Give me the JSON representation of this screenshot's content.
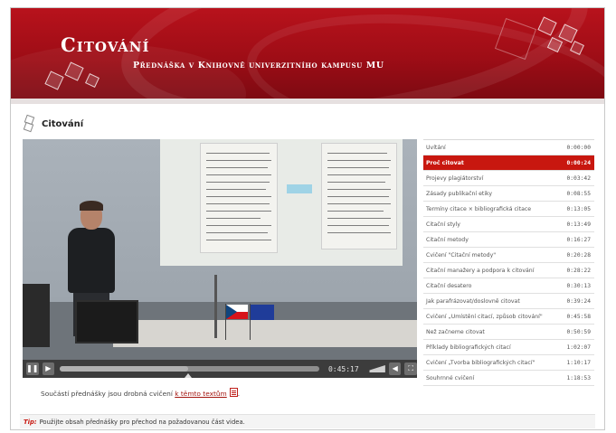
{
  "banner": {
    "title": "Citování",
    "subtitle": "Přednáška v Knihovně univerzitního kampusu MU"
  },
  "page": {
    "heading": "Citování"
  },
  "player": {
    "time": "0:45:17",
    "progress_fraction": 0.48,
    "play_icon": "play-icon",
    "pause_icon": "pause-icon",
    "volume_icon": "volume-icon",
    "fullscreen_icon": "fullscreen-icon"
  },
  "chapters": [
    {
      "title": "Uvítání",
      "time": "0:00:00"
    },
    {
      "title": "Proč citovat",
      "time": "0:00:24",
      "active": true
    },
    {
      "title": "Projevy plagiátorství",
      "time": "0:03:42"
    },
    {
      "title": "Zásady publikační etiky",
      "time": "0:08:55"
    },
    {
      "title": "Termíny citace × bibliografická citace",
      "time": "0:13:05"
    },
    {
      "title": "Citační styly",
      "time": "0:13:49"
    },
    {
      "title": "Citační metody",
      "time": "0:16:27"
    },
    {
      "title": "Cvičení \"Citační metody\"",
      "time": "0:20:28"
    },
    {
      "title": "Citační manažery a podpora k citování",
      "time": "0:28:22"
    },
    {
      "title": "Citační desatero",
      "time": "0:30:13"
    },
    {
      "title": "Jak parafrázovat/doslovně citovat",
      "time": "0:39:24"
    },
    {
      "title": "Cvičení „Umístění citací, způsob citování\"",
      "time": "0:45:58"
    },
    {
      "title": "Než začneme citovat",
      "time": "0:50:59"
    },
    {
      "title": "Příklady bibliografických citací",
      "time": "1:02:07"
    },
    {
      "title": "Cvičení „Tvorba bibliografických citací\"",
      "time": "1:10:17"
    },
    {
      "title": "Souhrnné cvičení",
      "time": "1:18:53"
    }
  ],
  "note": {
    "text": "Součástí přednášky jsou drobná cvičení ",
    "link": "k těmto textům",
    "end": "."
  },
  "tip": {
    "label": "Tip:",
    "text": "Použijte obsah přednášky pro přechod na požadovanou část videa."
  },
  "colors": {
    "brand_red": "#b8121c",
    "active_chapter": "#c8170f"
  }
}
